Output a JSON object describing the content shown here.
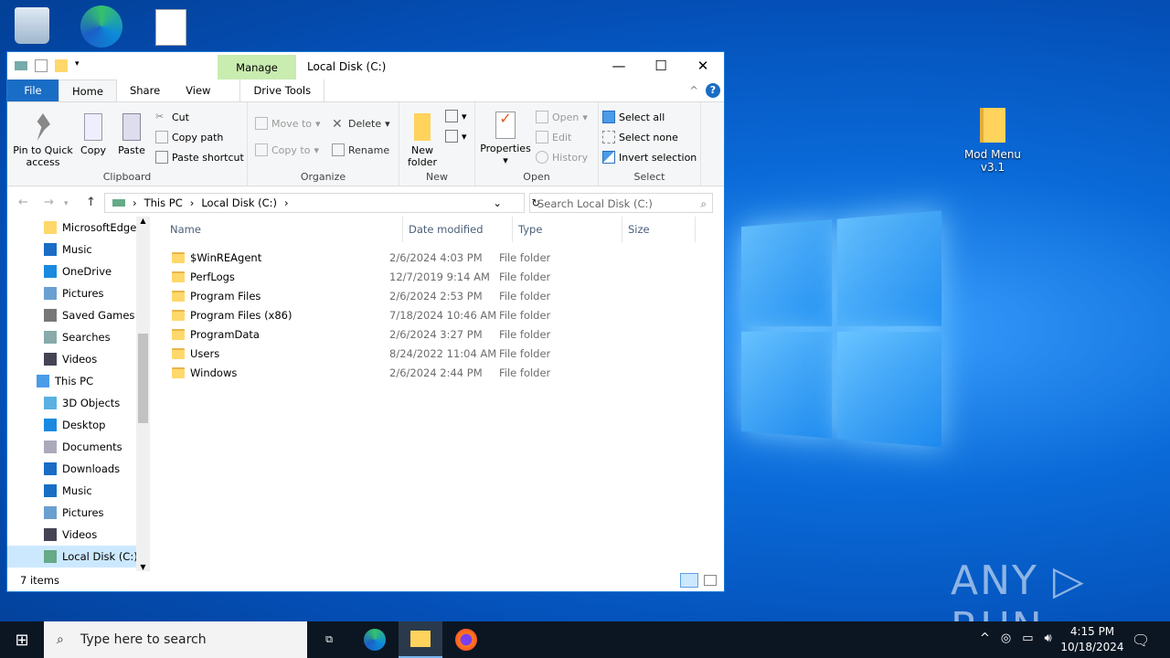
{
  "desktop": {
    "icons": [
      {
        "name": "Recycle Bin",
        "label": ""
      },
      {
        "name": "Microsoft Edge",
        "label": ""
      },
      {
        "name": "document",
        "label": ""
      }
    ],
    "mod_menu": "Mod Menu v3.1",
    "watermark": "ANY RUN"
  },
  "window": {
    "title": "Local Disk (C:)",
    "manage_tab": "Manage",
    "tabs": [
      "File",
      "Home",
      "Share",
      "View",
      "Drive Tools"
    ],
    "ribbon": {
      "clipboard": {
        "label": "Clipboard",
        "pin": "Pin to Quick access",
        "copy": "Copy",
        "paste": "Paste",
        "cut": "Cut",
        "copy_path": "Copy path",
        "paste_shortcut": "Paste shortcut"
      },
      "organize": {
        "label": "Organize",
        "move_to": "Move to",
        "copy_to": "Copy to",
        "delete": "Delete",
        "rename": "Rename"
      },
      "new": {
        "label": "New",
        "new_folder": "New folder"
      },
      "open": {
        "label": "Open",
        "properties": "Properties",
        "open": "Open",
        "edit": "Edit",
        "history": "History"
      },
      "select": {
        "label": "Select",
        "select_all": "Select all",
        "select_none": "Select none",
        "invert": "Invert selection"
      }
    },
    "address": {
      "crumbs": [
        "This PC",
        "Local Disk (C:)"
      ],
      "search_placeholder": "Search Local Disk (C:)"
    },
    "nav": [
      {
        "label": "MicrosoftEdge",
        "icon": "folder"
      },
      {
        "label": "Music",
        "icon": "music"
      },
      {
        "label": "OneDrive",
        "icon": "cloud"
      },
      {
        "label": "Pictures",
        "icon": "pictures"
      },
      {
        "label": "Saved Games",
        "icon": "games"
      },
      {
        "label": "Searches",
        "icon": "search"
      },
      {
        "label": "Videos",
        "icon": "video"
      },
      {
        "label": "This PC",
        "icon": "pc"
      },
      {
        "label": "3D Objects",
        "icon": "3d"
      },
      {
        "label": "Desktop",
        "icon": "desktop"
      },
      {
        "label": "Documents",
        "icon": "documents"
      },
      {
        "label": "Downloads",
        "icon": "download"
      },
      {
        "label": "Music",
        "icon": "music"
      },
      {
        "label": "Pictures",
        "icon": "pictures"
      },
      {
        "label": "Videos",
        "icon": "video"
      },
      {
        "label": "Local Disk (C:)",
        "icon": "drive",
        "selected": true
      }
    ],
    "columns": [
      "Name",
      "Date modified",
      "Type",
      "Size"
    ],
    "files": [
      {
        "name": "$WinREAgent",
        "date": "2/6/2024 4:03 PM",
        "type": "File folder"
      },
      {
        "name": "PerfLogs",
        "date": "12/7/2019 9:14 AM",
        "type": "File folder"
      },
      {
        "name": "Program Files",
        "date": "2/6/2024 2:53 PM",
        "type": "File folder"
      },
      {
        "name": "Program Files (x86)",
        "date": "7/18/2024 10:46 AM",
        "type": "File folder"
      },
      {
        "name": "ProgramData",
        "date": "2/6/2024 3:27 PM",
        "type": "File folder"
      },
      {
        "name": "Users",
        "date": "8/24/2022 11:04 AM",
        "type": "File folder"
      },
      {
        "name": "Windows",
        "date": "2/6/2024 2:44 PM",
        "type": "File folder"
      }
    ],
    "status": "7 items"
  },
  "taskbar": {
    "search_placeholder": "Type here to search",
    "time": "4:15 PM",
    "date": "10/18/2024"
  }
}
